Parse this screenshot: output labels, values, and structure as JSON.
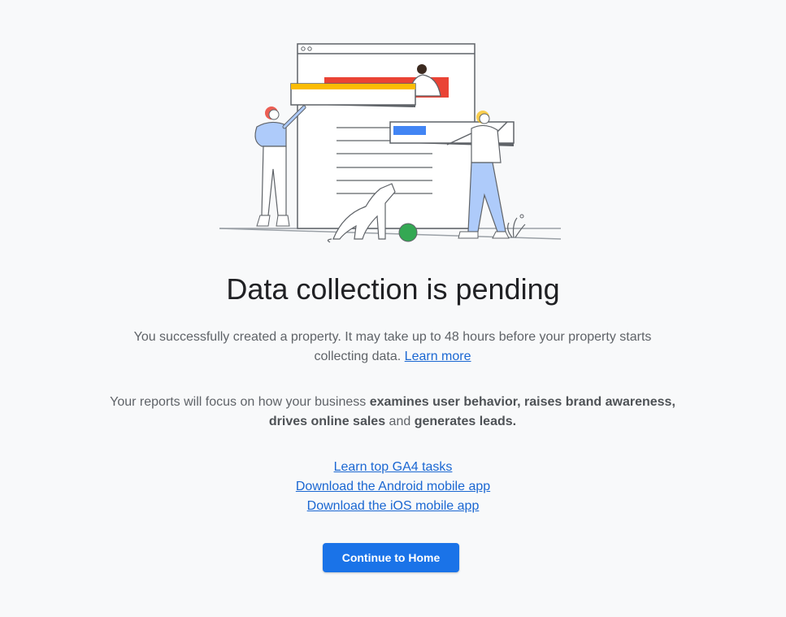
{
  "title": "Data collection is pending",
  "intro": {
    "text": "You successfully created a property. It may take up to 48 hours before your property starts collecting data. ",
    "link": "Learn more"
  },
  "focus": {
    "prefix": "Your reports will focus on how your business ",
    "bold1": "examines user behavior, raises brand awareness, drives online sales",
    "middle": " and ",
    "bold2": "generates leads."
  },
  "links": [
    "Learn top GA4 tasks",
    "Download the Android mobile app",
    "Download the iOS mobile app"
  ],
  "continue_button": "Continue to Home",
  "colors": {
    "accent": "#1a73e8",
    "link": "#1a67d2",
    "yellow": "#fbbc04",
    "red": "#ea4335",
    "green": "#34a853",
    "blue": "#4285f4"
  }
}
